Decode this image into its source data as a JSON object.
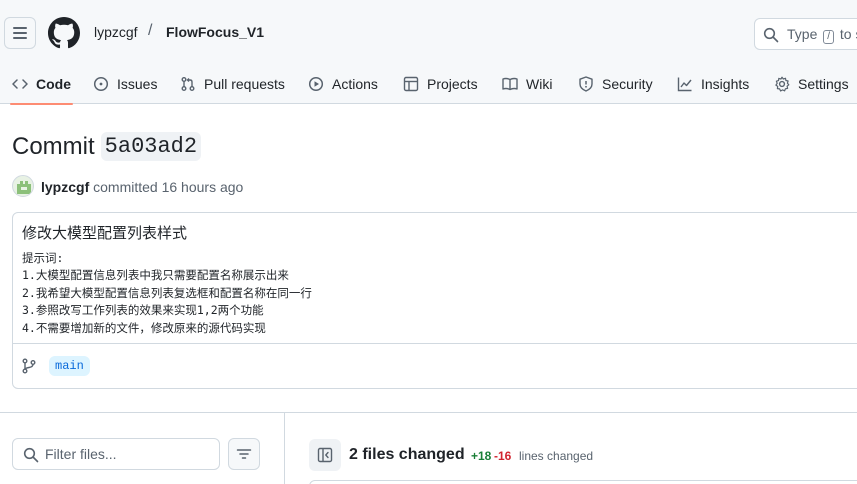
{
  "header": {
    "owner": "lypzcgf",
    "separator": "/",
    "repo": "FlowFocus_V1",
    "search_prefix": "Type",
    "search_key": "/",
    "search_suffix": "to s"
  },
  "nav": {
    "tabs": [
      {
        "label": "Code",
        "icon": "code-icon",
        "active": true
      },
      {
        "label": "Issues",
        "icon": "issue-icon"
      },
      {
        "label": "Pull requests",
        "icon": "pull-request-icon"
      },
      {
        "label": "Actions",
        "icon": "play-icon"
      },
      {
        "label": "Projects",
        "icon": "table-icon"
      },
      {
        "label": "Wiki",
        "icon": "book-icon"
      },
      {
        "label": "Security",
        "icon": "shield-icon"
      },
      {
        "label": "Insights",
        "icon": "graph-icon"
      },
      {
        "label": "Settings",
        "icon": "gear-icon"
      }
    ]
  },
  "commit": {
    "title_label": "Commit",
    "sha": "5a03ad2",
    "author": "lypzcgf",
    "action_text": "committed 16 hours ago",
    "message_title": "修改大模型配置列表样式",
    "message_body": "提示词:\n1.大模型配置信息列表中我只需要配置名称展示出来\n2.我希望大模型配置信息列表复选框和配置名称在同一行\n3.参照改写工作列表的效果来实现1,2两个功能\n4.不需要增加新的文件，修改原来的源代码实现",
    "branch": "main"
  },
  "files": {
    "filter_placeholder": "Filter files...",
    "changed_label": "2 files changed",
    "additions": "+18",
    "deletions": "-16",
    "lines_changed_label": "lines changed"
  },
  "colors": {
    "accent_tab": "#fd8c73",
    "additions": "#1a7f37",
    "deletions": "#d1242f",
    "branch_bg": "#ddf4ff",
    "branch_fg": "#0969da"
  }
}
